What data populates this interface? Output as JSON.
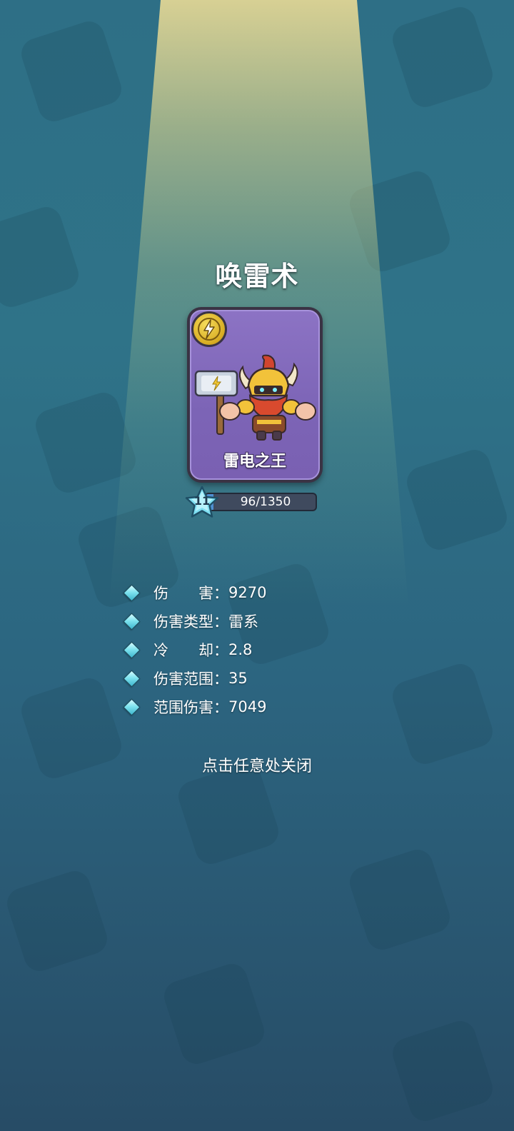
{
  "skill": {
    "title": "唤雷术",
    "element_icon": "lightning-icon",
    "element_color": "#e3bb2c"
  },
  "card": {
    "hero_name": "雷电之王",
    "card_color": "#7c64b6"
  },
  "level": {
    "value": "11",
    "xp_text": "96/1350",
    "xp_fraction": 0.071
  },
  "stats": [
    {
      "label": "伤　　害：",
      "value": "9270"
    },
    {
      "label": "伤害类型：",
      "value": "雷系"
    },
    {
      "label": "冷　　却：",
      "value": "2.8"
    },
    {
      "label": "伤害范围：",
      "value": "35"
    },
    {
      "label": "范围伤害：",
      "value": "7049"
    }
  ],
  "close_hint": "点击任意处关闭"
}
